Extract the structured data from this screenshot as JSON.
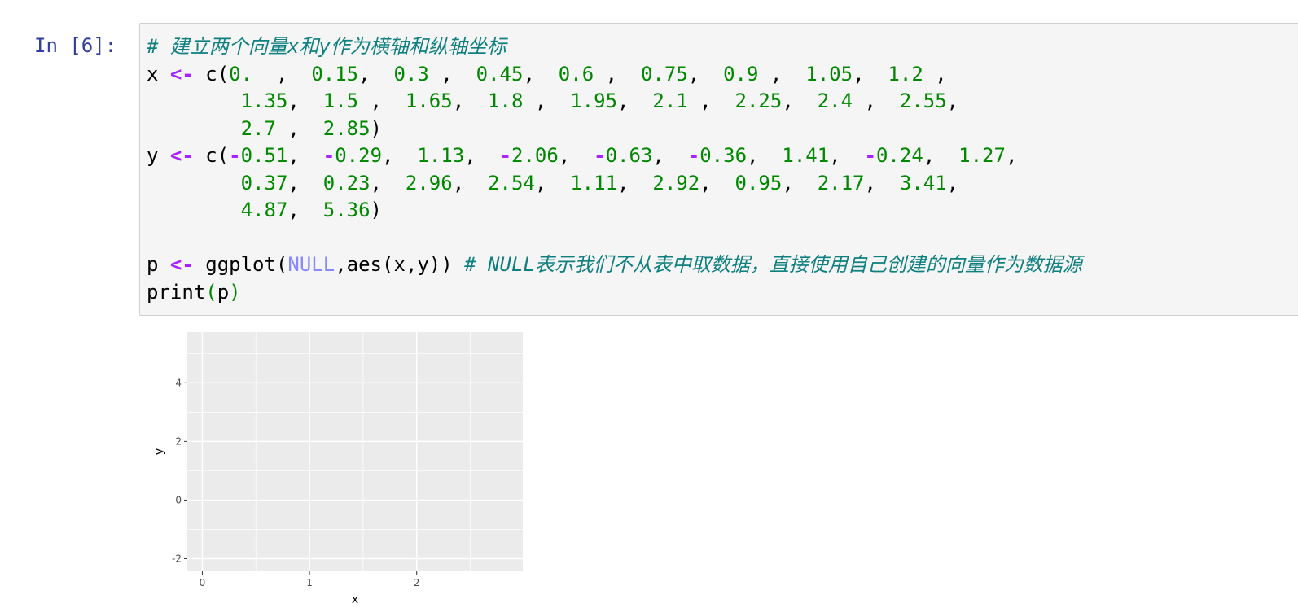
{
  "prompt": "In [6]:",
  "code": {
    "comment1": "# 建立两个向量x和y作为横轴和纵轴坐标",
    "x_name": "x",
    "assign": "<-",
    "c_open": " c(",
    "x_line1_vals": [
      "0.  ",
      "0.15",
      "0.3 ",
      "0.45",
      "0.6 ",
      "0.75",
      "0.9 ",
      "1.05",
      "1.2 "
    ],
    "x_line2_vals": [
      "1.35",
      "1.5 ",
      "1.65",
      "1.8 ",
      "1.95",
      "2.1 ",
      "2.25",
      "2.4 ",
      "2.55"
    ],
    "x_line3_vals": [
      "2.7 ",
      "2.85"
    ],
    "y_name": "y",
    "y_line1_vals": [
      "-0.51",
      "-0.29",
      "1.13",
      "-2.06",
      "-0.63",
      "-0.36",
      "1.41",
      "-0.24",
      "1.27"
    ],
    "y_line2_vals": [
      "0.37",
      "0.23",
      "2.96",
      "2.54",
      "1.11",
      "2.92",
      "0.95",
      "2.17",
      "3.41"
    ],
    "y_line3_vals": [
      "4.87",
      "5.36"
    ],
    "p_name": "p",
    "ggplot_open": " ggplot(",
    "null_kw": "NULL",
    "aes_part": ",aes(x,y))",
    "comment2": "# NULL表示我们不从表中取数据，直接使用自己创建的向量作为数据源",
    "print_fn": "print",
    "print_open": "(",
    "print_arg": "p",
    "print_close": ")"
  },
  "chart_data": {
    "type": "scatter",
    "x": [],
    "y": [],
    "xlabel": "x",
    "ylabel": "y",
    "xlim": [
      -0.14,
      2.99
    ],
    "ylim": [
      -2.43,
      5.73
    ],
    "xticks": [
      "0",
      "1",
      "2"
    ],
    "yticks": [
      "-2",
      "0",
      "2",
      "4"
    ],
    "panel_background": "#ebebeb",
    "grid": true,
    "grid_color": "#ffffff"
  }
}
